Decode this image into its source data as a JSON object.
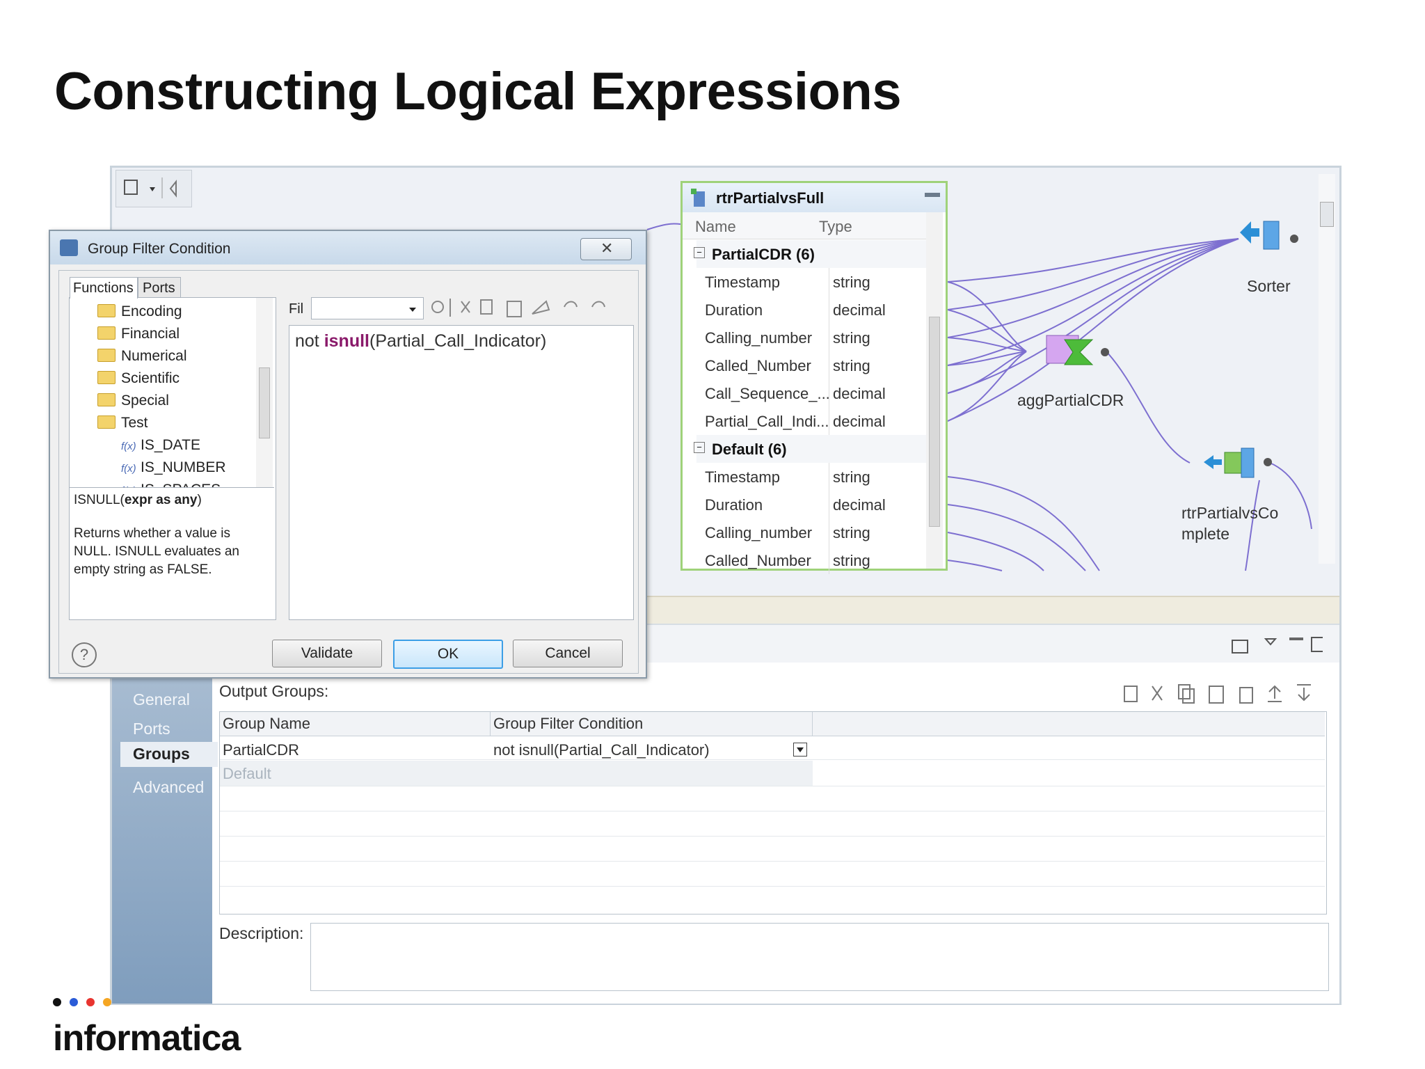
{
  "slide": {
    "title": "Constructing Logical Expressions",
    "logo_text": "informatica"
  },
  "router": {
    "title": "rtrPartialvsFull",
    "col_name": "Name",
    "col_type": "Type",
    "groups": [
      {
        "label": "PartialCDR (6)",
        "rows": [
          {
            "name": "Timestamp",
            "type": "string"
          },
          {
            "name": "Duration",
            "type": "decimal"
          },
          {
            "name": "Calling_number",
            "type": "string"
          },
          {
            "name": "Called_Number",
            "type": "string"
          },
          {
            "name": "Call_Sequence_...",
            "type": "decimal"
          },
          {
            "name": "Partial_Call_Indi...",
            "type": "decimal"
          }
        ]
      },
      {
        "label": "Default (6)",
        "rows": [
          {
            "name": "Timestamp",
            "type": "string"
          },
          {
            "name": "Duration",
            "type": "decimal"
          },
          {
            "name": "Calling_number",
            "type": "string"
          },
          {
            "name": "Called_Number",
            "type": "string"
          }
        ]
      }
    ]
  },
  "nodes": {
    "sorter": "Sorter",
    "aggregator": "aggPartialCDR",
    "router2_line1": "rtrPartialvsCo",
    "router2_line2": "mplete"
  },
  "dialog": {
    "title": "Group Filter Condition",
    "tab_functions": "Functions",
    "tab_ports": "Ports",
    "filter_label": "Fil",
    "folders": [
      "Encoding",
      "Financial",
      "Numerical",
      "Scientific",
      "Special",
      "Test"
    ],
    "functions": [
      "IS_DATE",
      "IS_NUMBER",
      "IS_SPACES"
    ],
    "signature_name": "ISNULL(",
    "signature_args": "expr as any",
    "signature_close": ")",
    "description": "Returns whether a value is NULL. ISNULL evaluates an empty string as FALSE.",
    "expr_prefix": "not ",
    "expr_function": "isnull",
    "expr_args": "(Partial_Call_Indicator)",
    "validate_label": "Validate",
    "ok_label": "OK",
    "cancel_label": "Cancel",
    "help_symbol": "?"
  },
  "properties": {
    "nav": [
      "General",
      "Ports",
      "Groups",
      "Advanced"
    ],
    "output_groups_label": "Output Groups:",
    "col_group_name": "Group Name",
    "col_group_filter": "Group Filter Condition",
    "rows": [
      {
        "name": "PartialCDR",
        "condition": "not isnull(Partial_Call_Indicator)"
      },
      {
        "name": "Default",
        "condition": ""
      }
    ],
    "description_label": "Description:"
  }
}
